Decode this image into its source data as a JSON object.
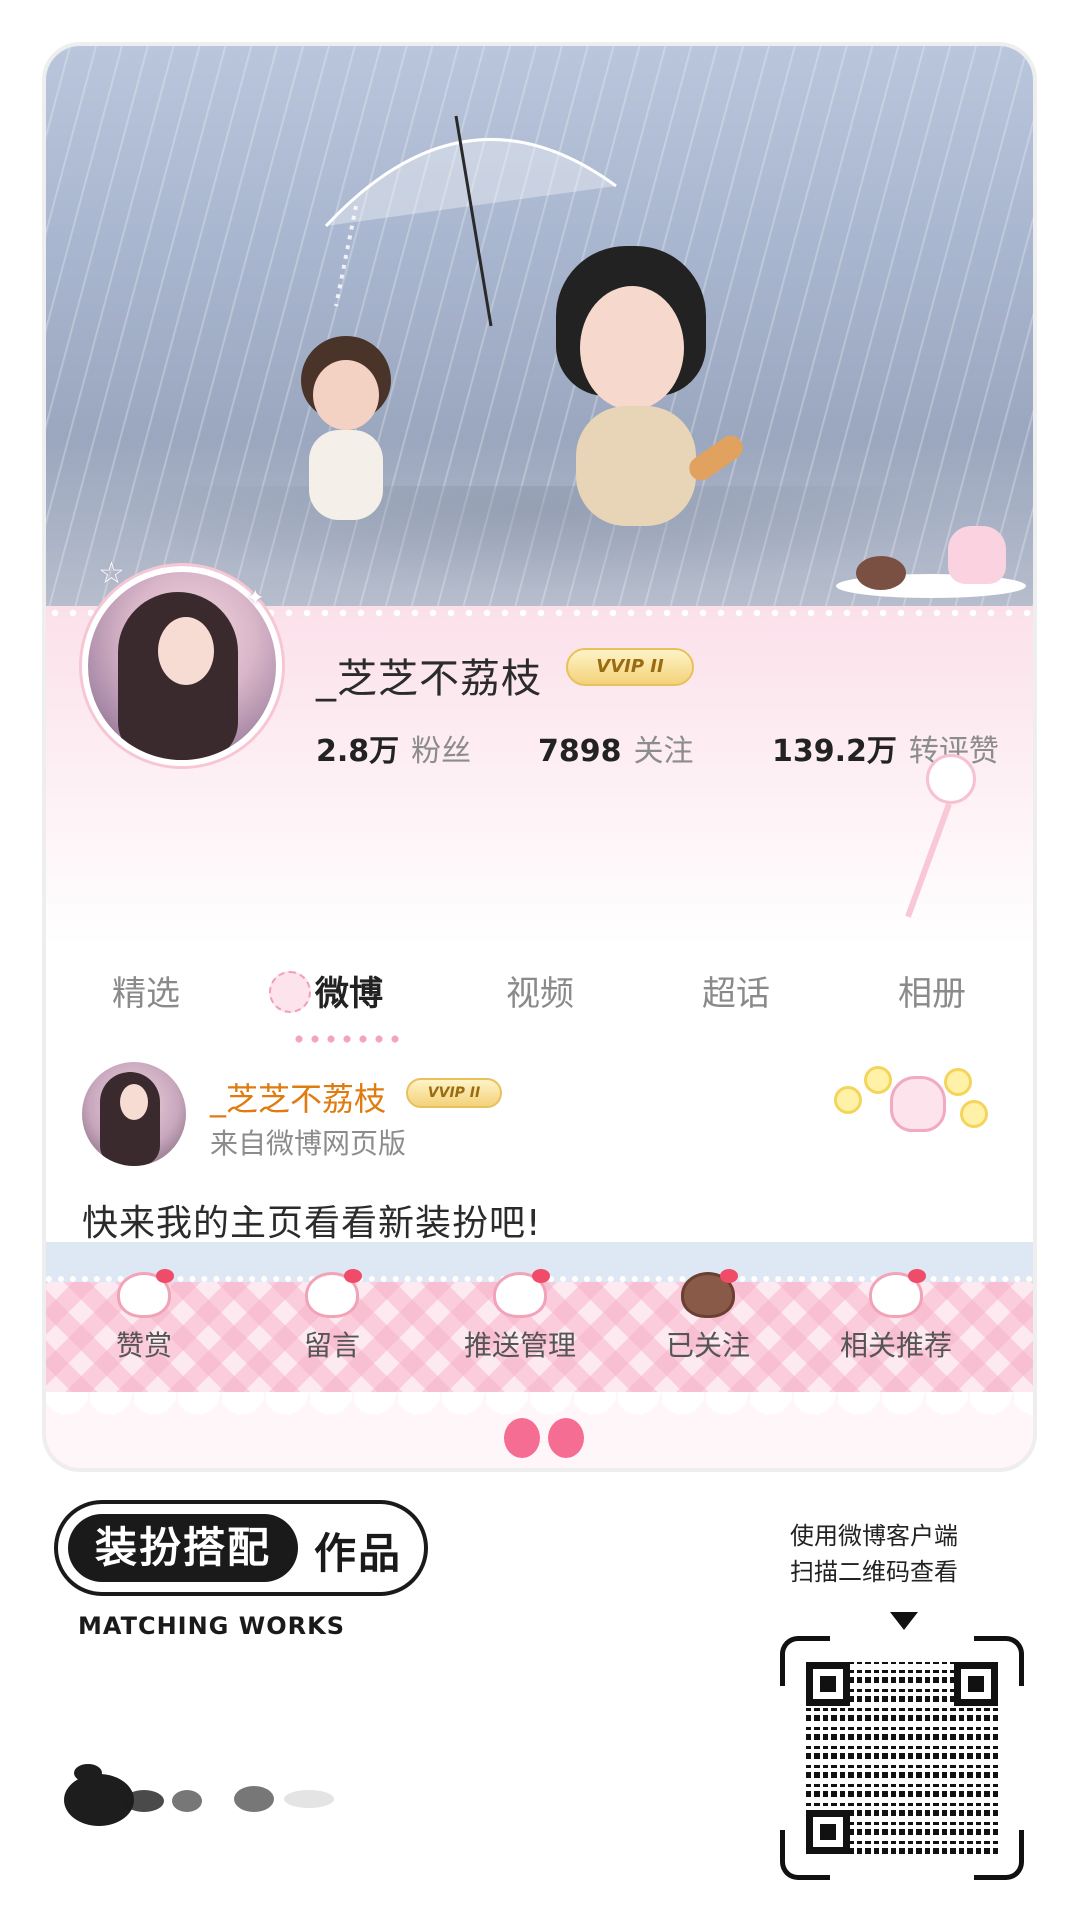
{
  "profile": {
    "username": "_芝芝不荔枝",
    "vip_badge": "VVIP II",
    "stats": [
      {
        "value": "2.8万",
        "label": "粉丝"
      },
      {
        "value": "7898",
        "label": "关注"
      },
      {
        "value": "139.2万",
        "label": "转评赞"
      }
    ]
  },
  "tabs": [
    {
      "label": "精选",
      "active": false
    },
    {
      "label": "微博",
      "active": true
    },
    {
      "label": "视频",
      "active": false
    },
    {
      "label": "超话",
      "active": false
    },
    {
      "label": "相册",
      "active": false
    }
  ],
  "post": {
    "author": "_芝芝不荔枝",
    "vip_badge": "VVIP II",
    "source": "来自微博网页版",
    "text": "快来我的主页看看新装扮吧!"
  },
  "action_bar": [
    {
      "label": "赞赏",
      "icon": "hello-kitty-icon"
    },
    {
      "label": "留言",
      "icon": "hello-kitty-icon"
    },
    {
      "label": "推送管理",
      "icon": "hello-kitty-icon"
    },
    {
      "label": "已关注",
      "icon": "donut-icon"
    },
    {
      "label": "相关推荐",
      "icon": "hello-kitty-icon"
    }
  ],
  "footer": {
    "badge_main": "装扮搭配",
    "badge_suffix": "作品",
    "badge_sub": "MATCHING WORKS",
    "qr_hint_line1": "使用微博客户端",
    "qr_hint_line2": "扫描二维码查看"
  },
  "colors": {
    "accent_pink": "#f4a3bd",
    "author_orange": "#e07b10",
    "vip_gold": "#f3d27a"
  }
}
